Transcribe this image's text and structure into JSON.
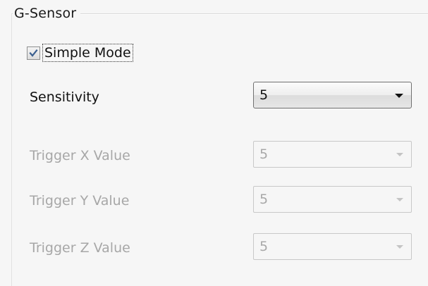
{
  "group": {
    "title": "G-Sensor"
  },
  "simple_mode": {
    "label": "Simple Mode",
    "checked": true,
    "icon": "checkmark-icon"
  },
  "sensitivity": {
    "label": "Sensitivity",
    "value": "5",
    "arrow_icon": "chevron-down-icon"
  },
  "trigger_x": {
    "label": "Trigger X Value",
    "value": "5",
    "enabled": false
  },
  "trigger_y": {
    "label": "Trigger Y Value",
    "value": "5",
    "enabled": false
  },
  "trigger_z": {
    "label": "Trigger Z Value",
    "value": "5",
    "enabled": false
  },
  "colors": {
    "background": "#f6f6f6",
    "text": "#111111",
    "disabled_text": "#a7a7a7",
    "check_mark": "#3b5f8f"
  }
}
